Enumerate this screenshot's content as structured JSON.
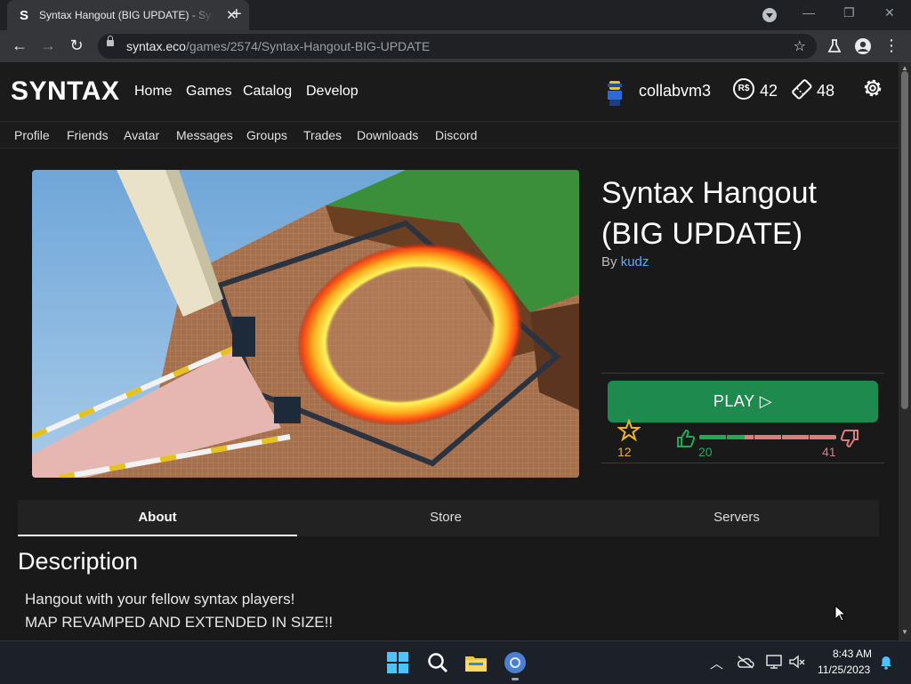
{
  "browser": {
    "tab_title": "Syntax Hangout (BIG UPDATE) - Syntax",
    "tab_favicon": "S",
    "url_domain": "syntax.eco",
    "url_path": "/games/2574/Syntax-Hangout-BIG-UPDATE"
  },
  "site": {
    "logo": "SYNTAX",
    "nav": [
      "Home",
      "Games",
      "Catalog",
      "Develop"
    ],
    "username": "collabvm3",
    "robux_symbol": "R$",
    "robux": "42",
    "tickets": "48",
    "subnav": [
      "Profile",
      "Friends",
      "Avatar",
      "Messages",
      "Groups",
      "Trades",
      "Downloads",
      "Discord"
    ]
  },
  "game": {
    "title": "Syntax Hangout (BIG UPDATE)",
    "by_label": "By",
    "creator": "kudz",
    "play_label": "PLAY ▷",
    "favorites": "12",
    "upvotes": "20",
    "downvotes": "41",
    "upvote_fraction": 0.33
  },
  "tabs": [
    "About",
    "Store",
    "Servers"
  ],
  "description": {
    "heading": "Description",
    "lines": [
      "Hangout with your fellow syntax players!",
      "MAP REVAMPED AND EXTENDED IN SIZE!!"
    ]
  },
  "taskbar": {
    "time": "8:43 AM",
    "date": "11/25/2023"
  },
  "colors": {
    "accent_green": "#1e8a4e",
    "link_blue": "#5fa8ff",
    "dislike_red": "#e07b7b",
    "star_gold": "#f0b429"
  }
}
